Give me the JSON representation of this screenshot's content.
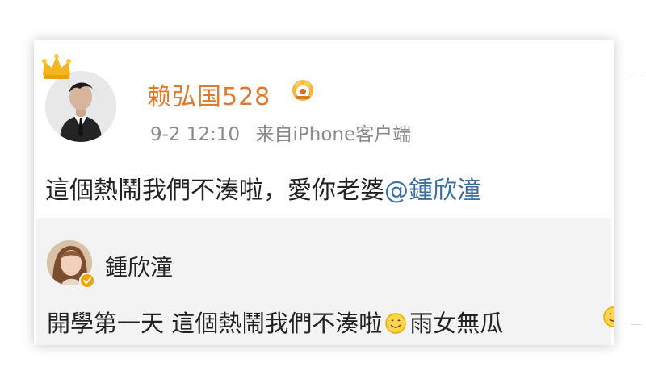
{
  "post": {
    "username": "赖弘国528",
    "time": "9-2 12:10",
    "source": "来自iPhone客户端",
    "text": "這個熱鬧我們不湊啦，愛你老婆",
    "mention": "@鍾欣潼"
  },
  "repost": {
    "username": "鍾欣潼",
    "text_part1": "開學第一天 這個熱鬧我們不湊啦",
    "text_part2": "雨女無瓜"
  },
  "icons": {
    "crown": "crown-icon",
    "vip": "vip-badge-icon",
    "emoji": "smile-emoji-icon",
    "verified": "verified-badge-icon"
  },
  "colors": {
    "username": "#e07a2c",
    "mention": "#3d6f9e",
    "meta": "#8a8a8a",
    "repost_bg": "#f3f3f3"
  }
}
